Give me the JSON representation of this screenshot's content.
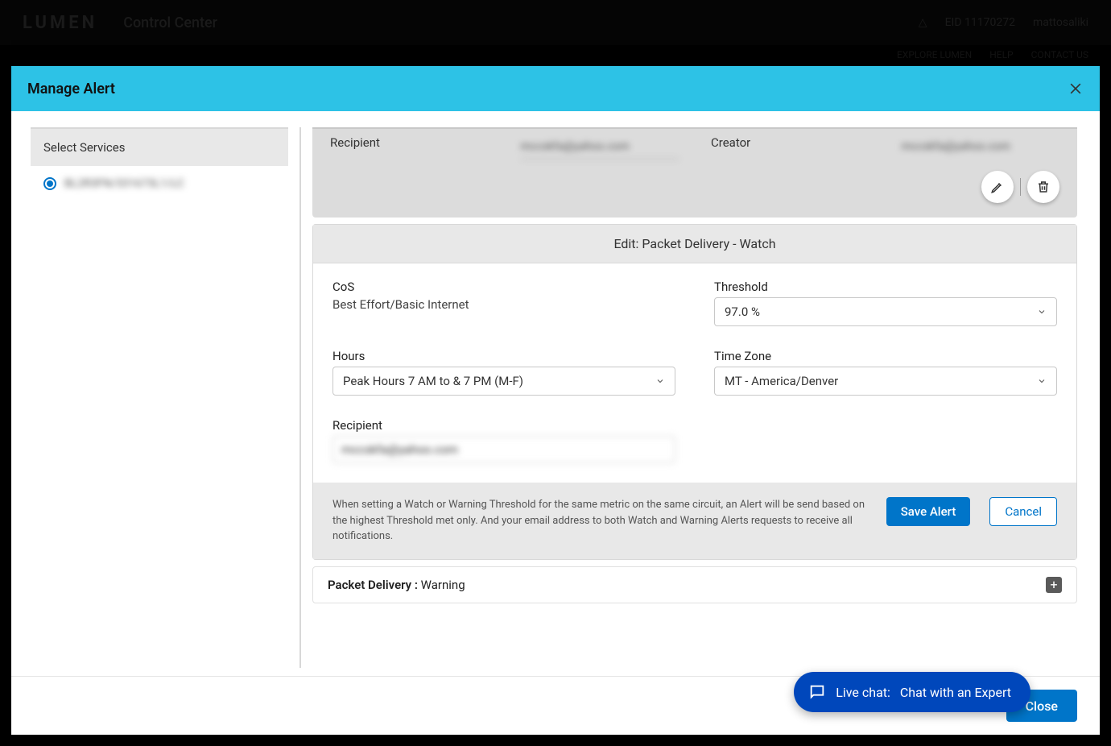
{
  "bg": {
    "logo": "LUMEN",
    "app": "Control Center",
    "eid": "EID 11170272",
    "user": "mattosaliki",
    "subnav": {
      "explore": "EXPLORE LUMEN",
      "help": "HELP",
      "contact": "CONTACT US"
    }
  },
  "modal": {
    "title": "Manage Alert",
    "sidebar": {
      "heading": "Select Services",
      "service_id": "BL2R3FN/331673L1/LC"
    },
    "top": {
      "recipient_label": "Recipient",
      "recipient_value": "mccskfa@yahoo.com",
      "creator_label": "Creator",
      "creator_value": "mccskfa@yahoo.com"
    },
    "edit": {
      "heading": "Edit: Packet Delivery - Watch",
      "cos_label": "CoS",
      "cos_value": "Best Effort/Basic Internet",
      "threshold_label": "Threshold",
      "threshold_value": "97.0 %",
      "hours_label": "Hours",
      "hours_value": "Peak Hours 7 AM to & 7 PM (M-F)",
      "tz_label": "Time Zone",
      "tz_value": "MT - America/Denver",
      "recipient_label": "Recipient",
      "recipient_value": "mccskfa@yahoo.com",
      "help": "When setting a Watch or Warning Threshold for the same metric on the same circuit, an Alert will be send based on the highest Threshold met only. And your email address to both Watch and Warning Alerts requests to receive all notifications.",
      "save": "Save Alert",
      "cancel": "Cancel"
    },
    "accordion": {
      "metric": "Packet Delivery :",
      "level": " Warning"
    },
    "close": "Close"
  },
  "chat": {
    "prefix": "Live chat:",
    "label": "Chat with an Expert"
  }
}
